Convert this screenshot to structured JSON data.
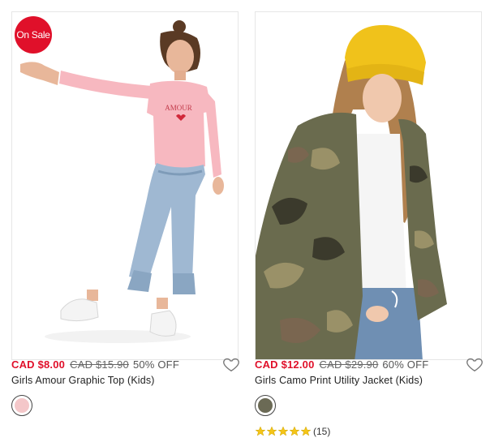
{
  "products": [
    {
      "badge": "On Sale",
      "sale_price": "CAD $8.00",
      "original_price": "CAD $15.90",
      "discount": "50% OFF",
      "title": "Girls Amour Graphic Top (Kids)",
      "shirt_print": "AMOUR",
      "swatch_color": "#f4c7c9",
      "swatch_name": "pink"
    },
    {
      "sale_price": "CAD $12.00",
      "original_price": "CAD $29.90",
      "discount": "60% OFF",
      "title": "Girls Camo Print Utility Jacket (Kids)",
      "swatch_color": "#6b6a55",
      "swatch_name": "camo",
      "rating_count": "(15)",
      "rating_stars": 5
    }
  ],
  "colors": {
    "sale_red": "#e0102a",
    "star_yellow": "#f5c518"
  }
}
